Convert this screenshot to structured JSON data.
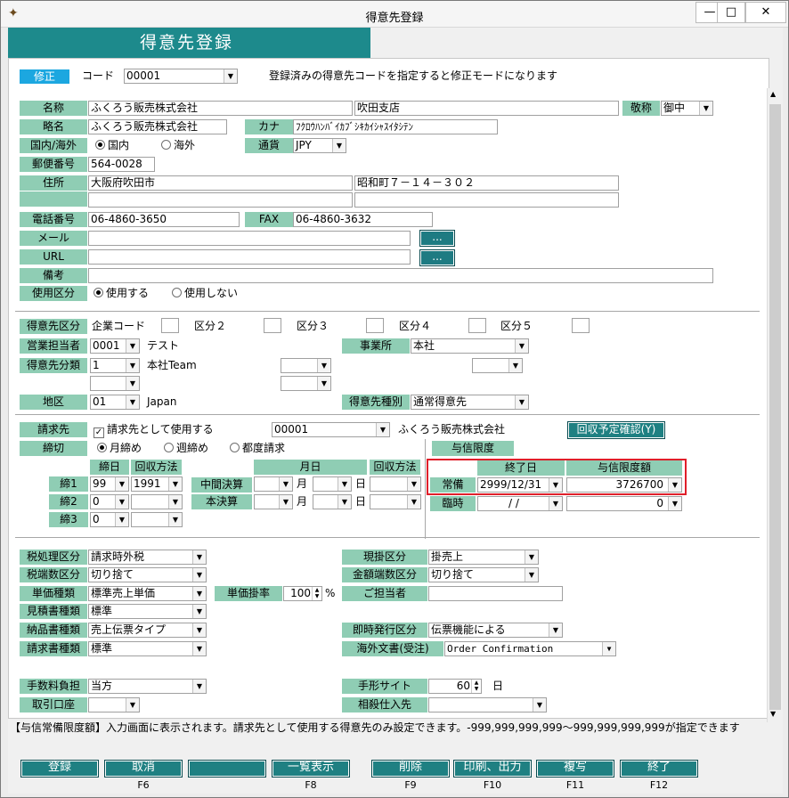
{
  "window": {
    "title": "得意先登録",
    "min": "—",
    "max": "□",
    "close": "✕"
  },
  "header": {
    "banner": "得意先登録"
  },
  "top": {
    "mode": "修正",
    "code_label": "コード",
    "code": "00001",
    "hint": "登録済みの得意先コードを指定すると修正モードになります"
  },
  "basic": {
    "name_label": "名称",
    "name1": "ふくろう販売株式会社",
    "name2": "吹田支店",
    "honor_label": "敬称",
    "honor": "御中",
    "short_label": "略名",
    "short": "ふくろう販売株式会社",
    "kana_label": "カナ",
    "kana": "ﾌｸﾛｳﾊﾝﾊﾞｲｶﾌﾞｼｷｶｲｼｬｽｲﾀｼﾃﾝ",
    "domestic_label": "国内/海外",
    "domestic": "国内",
    "overseas": "海外",
    "currency_label": "通貨",
    "currency": "JPY",
    "zip_label": "郵便番号",
    "zip": "564-0028",
    "addr_label": "住所",
    "addr1": "大阪府吹田市",
    "addr2": "昭和町７－１４－３０２",
    "tel_label": "電話番号",
    "tel": "06-4860-3650",
    "fax_label": "FAX",
    "fax": "06-4860-3632",
    "mail_label": "メール",
    "url_label": "URL",
    "dots": "...",
    "note_label": "備考",
    "use_label": "使用区分",
    "use_yes": "使用する",
    "use_no": "使用しない"
  },
  "classify": {
    "kbn_label": "得意先区分",
    "corp_code": "企業コード",
    "kbn2": "区分２",
    "kbn3": "区分３",
    "kbn4": "区分４",
    "kbn5": "区分５",
    "rep_label": "営業担当者",
    "rep_code": "0001",
    "rep_name": "テスト",
    "office_label": "事業所",
    "office": "本社",
    "cat_label": "得意先分類",
    "cat_code": "1",
    "cat_name": "本社Team",
    "area_label": "地区",
    "area_code": "01",
    "area_name": "Japan",
    "type_label": "得意先種別",
    "type": "通常得意先"
  },
  "billing": {
    "bill_label": "請求先",
    "bill_check": "請求先として使用する",
    "bill_code": "00001",
    "bill_name": "ふくろう販売株式会社",
    "plan_btn": "回収予定確認(Y)",
    "close_label": "締切",
    "monthly": "月締め",
    "weekly": "週締め",
    "each": "都度請求",
    "day_hdr": "締日",
    "method_hdr": "回収方法",
    "monthday_hdr": "月日",
    "method_hdr2": "回収方法",
    "c1": "締1",
    "c2": "締2",
    "c3": "締3",
    "c1_day": "99",
    "c1_method": "1991",
    "c2_day": "0",
    "c3_day": "0",
    "mid_label": "中間決算",
    "final_label": "本決算",
    "month": "月",
    "day": "日",
    "credit_label": "与信限度",
    "end_hdr": "終了日",
    "limit_hdr": "与信限度額",
    "normal": "常備",
    "normal_end": "2999/12/31",
    "normal_limit": "3726700",
    "temp": "臨時",
    "temp_end": "/   /",
    "temp_limit": "0"
  },
  "tax": {
    "tax_label": "税処理区分",
    "tax": "請求時外税",
    "taxround_label": "税端数区分",
    "taxround": "切り捨て",
    "price_label": "単価種類",
    "price": "標準売上単価",
    "rate_label": "単価掛率",
    "rate": "100",
    "pct": "%",
    "est_label": "見積書種類",
    "est": "標準",
    "deliv_label": "納品書種類",
    "deliv": "売上伝票タイプ",
    "inv_label": "請求書種類",
    "inv": "標準",
    "cash_label": "現掛区分",
    "cash": "掛売上",
    "amtround_label": "金額端数区分",
    "amtround": "切り捨て",
    "person_label": "ご担当者",
    "instant_label": "即時発行区分",
    "instant": "伝票機能による",
    "foreign_label": "海外文書(受注)",
    "foreign": "Order Confirmation",
    "fee_label": "手数料負担",
    "fee": "当方",
    "bank_label": "取引口座",
    "bill_site_label": "手形サイト",
    "bill_site": "60",
    "day": "日",
    "offset_label": "相殺仕入先"
  },
  "status": {
    "msg": "【与信常備限度額】入力画面に表示されます。請求先として使用する得意先のみ設定できます。-999,999,999,999～999,999,999,999が指定できます"
  },
  "fbuttons": [
    {
      "label": "登録",
      "key": ""
    },
    {
      "label": "取消",
      "key": "F6"
    },
    {
      "label": "",
      "key": ""
    },
    {
      "label": "一覧表示",
      "key": "F8"
    },
    {
      "label": "削除",
      "key": "F9"
    },
    {
      "label": "印刷、出力",
      "key": "F10"
    },
    {
      "label": "複写",
      "key": "F11"
    },
    {
      "label": "終了",
      "key": "F12"
    }
  ],
  "colors": {
    "label_bg": "#8fcdb4",
    "banner": "#1d8a8c",
    "highlight": "#e01f2a",
    "input_yellow": "#ffff66"
  }
}
